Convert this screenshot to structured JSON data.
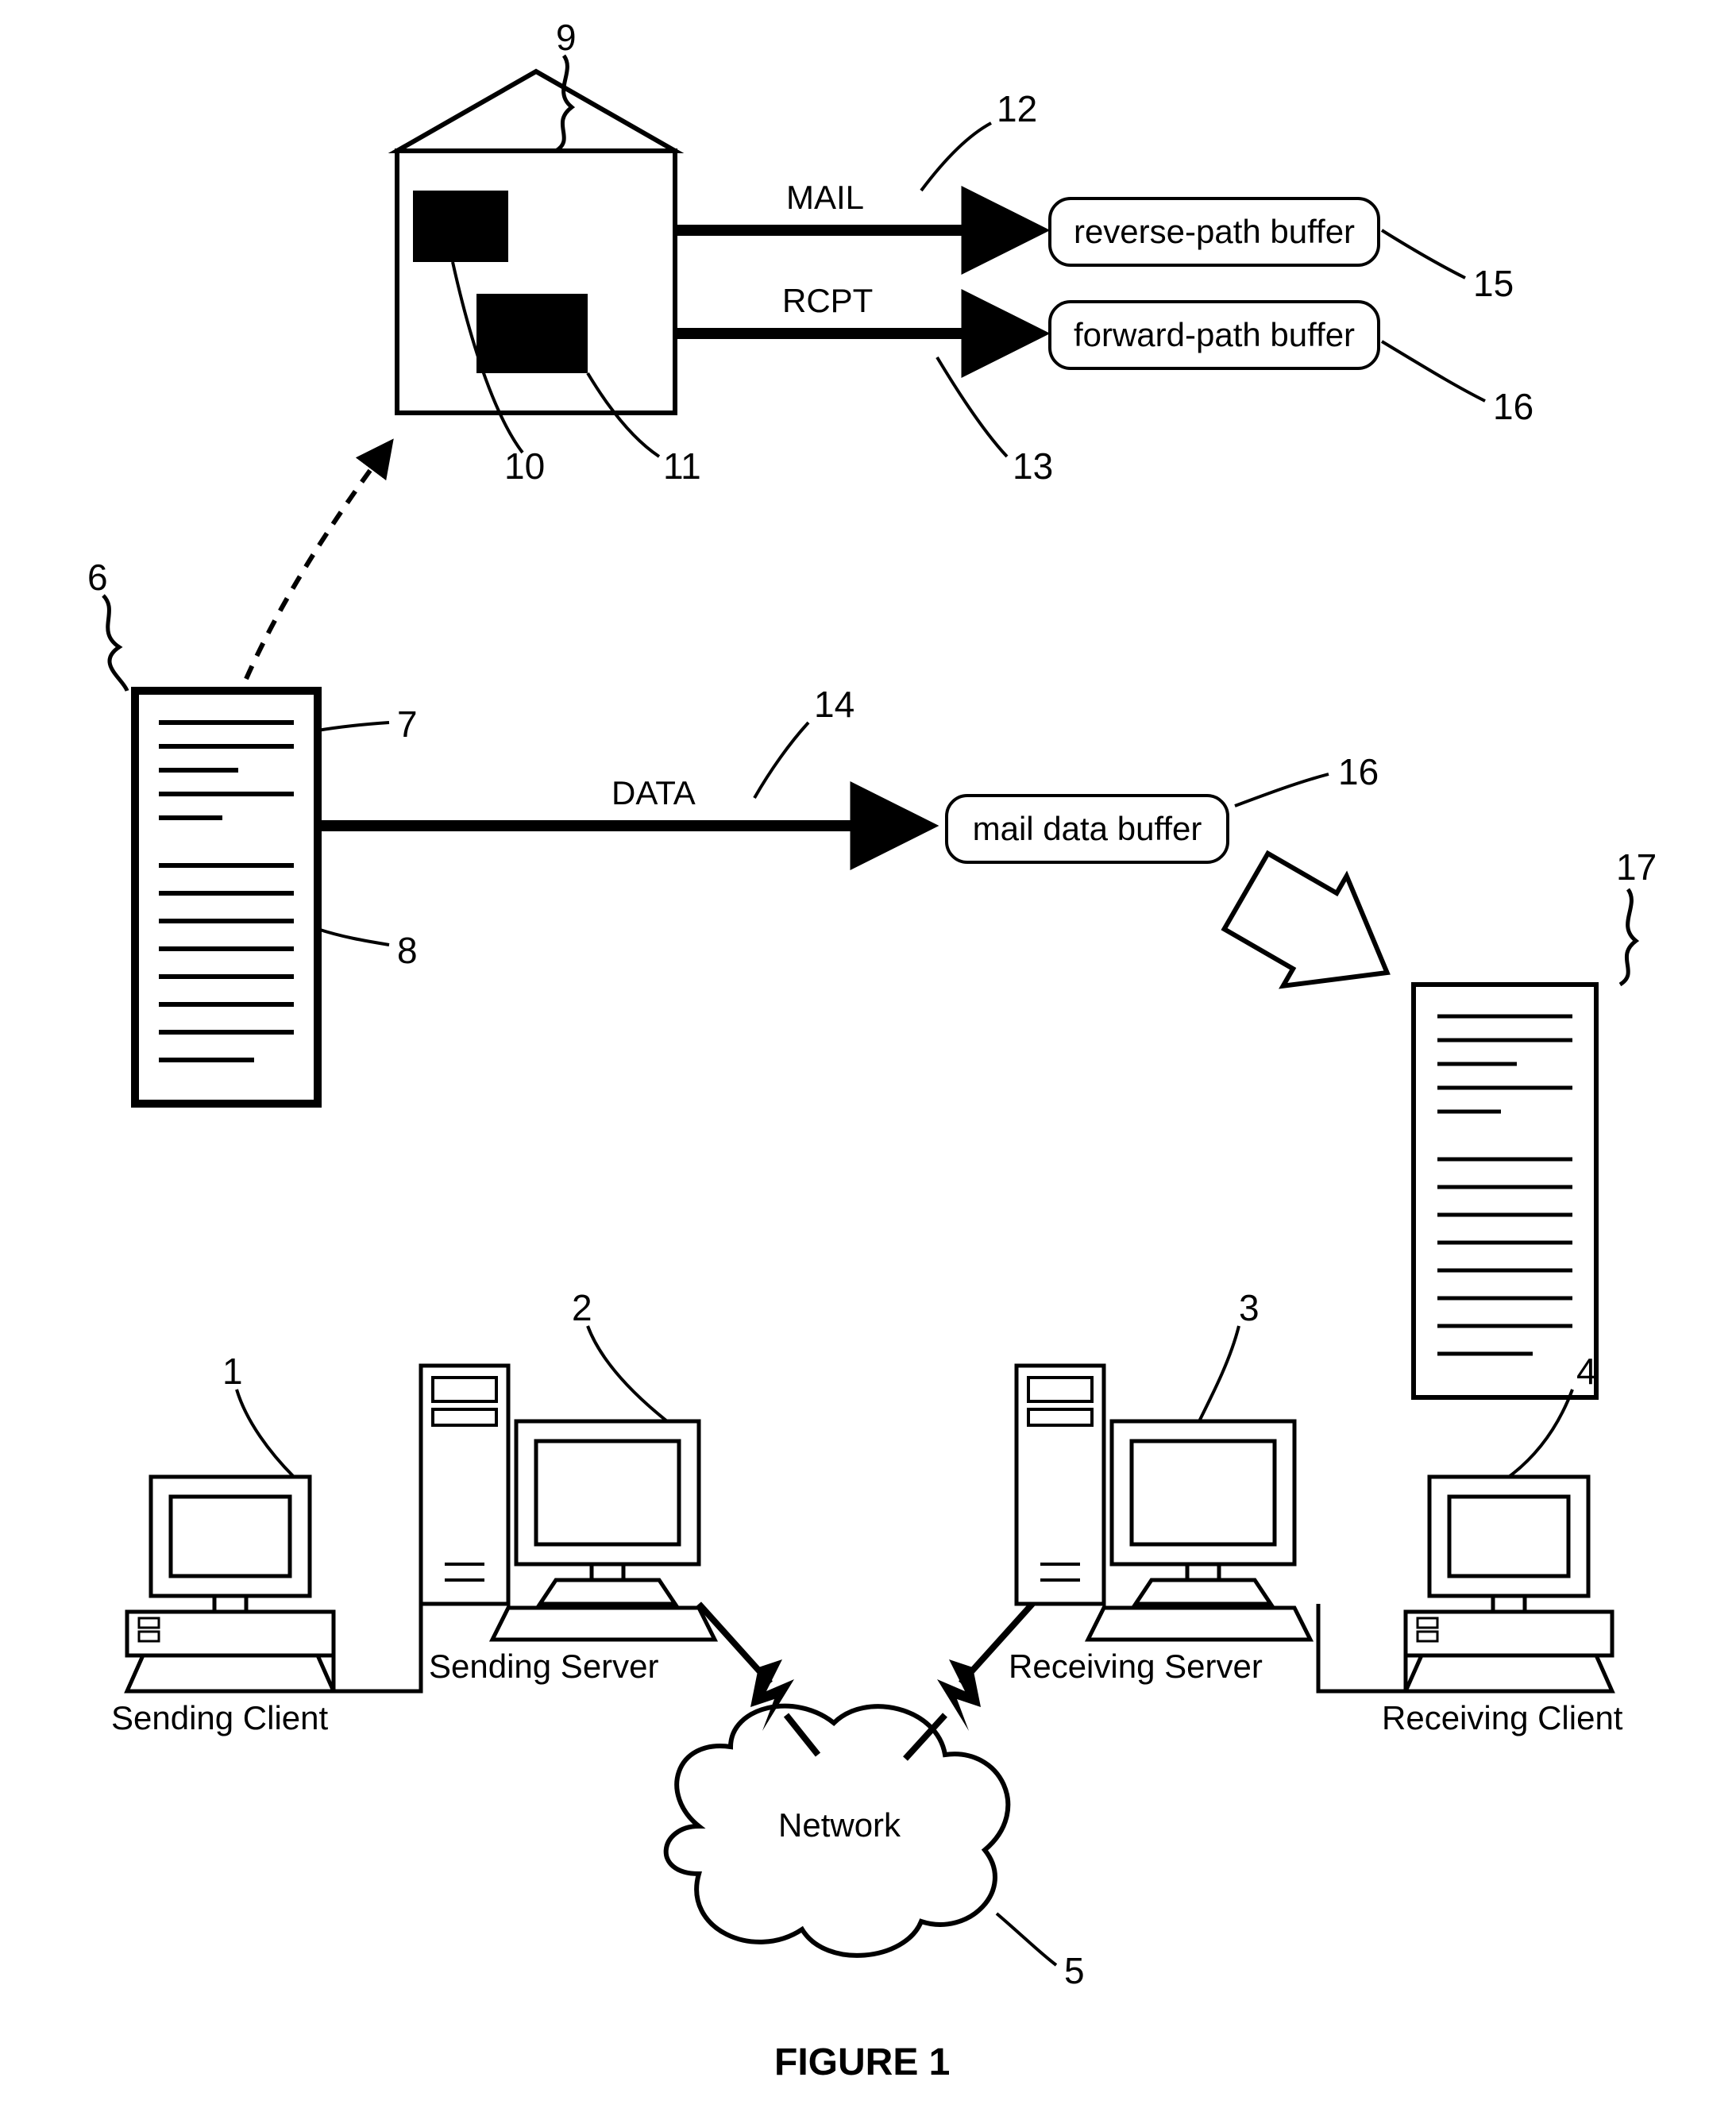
{
  "labels": {
    "mail": "MAIL",
    "rcpt": "RCPT",
    "data": "DATA",
    "reverse_path_buffer": "reverse-path buffer",
    "forward_path_buffer": "forward-path buffer",
    "mail_data_buffer": "mail data buffer",
    "sending_client": "Sending Client",
    "sending_server": "Sending Server",
    "receiving_server": "Receiving Server",
    "receiving_client": "Receiving Client",
    "network": "Network"
  },
  "callouts": {
    "c1": "1",
    "c2": "2",
    "c3": "3",
    "c4": "4",
    "c5": "5",
    "c6": "6",
    "c7": "7",
    "c8": "8",
    "c9": "9",
    "c10": "10",
    "c11": "11",
    "c12": "12",
    "c13": "13",
    "c14": "14",
    "c15": "15",
    "c16a": "16",
    "c16b": "16",
    "c17": "17"
  },
  "figure_title": "FIGURE 1"
}
